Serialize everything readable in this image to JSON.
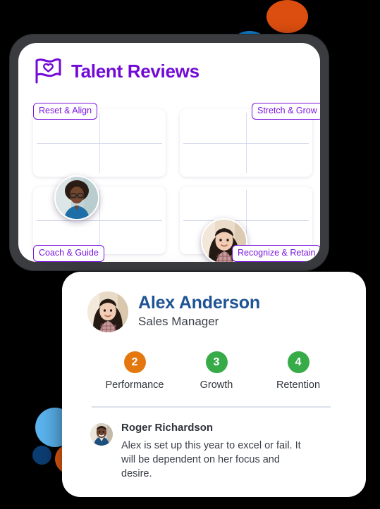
{
  "panel": {
    "title": "Talent Reviews",
    "logo_icon": "flag-heart-icon",
    "brand_color": "#7209D6"
  },
  "grid": {
    "quadrants": [
      {
        "id": "reset-align",
        "tag": "Reset & Align"
      },
      {
        "id": "stretch-grow",
        "tag": "Stretch & Grow"
      },
      {
        "id": "coach-guide",
        "tag": "Coach & Guide"
      },
      {
        "id": "recognize-retain",
        "tag": "Recognize & Retain"
      }
    ],
    "placed_employees": [
      {
        "id": "employee-marker-1",
        "avatar": "woman-glasses-blue-top-avatar"
      },
      {
        "id": "employee-marker-2",
        "avatar": "woman-dark-hair-plaid-avatar"
      }
    ]
  },
  "profile": {
    "avatar_icon": "woman-dark-hair-plaid-avatar",
    "name": "Alex Anderson",
    "role": "Sales Manager",
    "name_color": "#1F5394",
    "scores": [
      {
        "label": "Performance",
        "value": "2",
        "color": "#E4780F"
      },
      {
        "label": "Growth",
        "value": "3",
        "color": "#38AB49"
      },
      {
        "label": "Retention",
        "value": "4",
        "color": "#38AB49"
      }
    ],
    "comment": {
      "avatar_icon": "man-smiling-avatar",
      "author": "Roger Richardson",
      "text": "Alex is set up this year to excel or fail. It will be dependent on her focus and desire."
    }
  },
  "decorations": {
    "circles": [
      {
        "name": "orange-circle-top",
        "color": "#DC4E10"
      },
      {
        "name": "blue-circle-top",
        "color": "#1080CE"
      },
      {
        "name": "dark-circle-top",
        "color": "#26292E"
      },
      {
        "name": "light-blue-circle-bottom",
        "color": "#5BB4F0"
      },
      {
        "name": "navy-circle-bottom",
        "color": "#0C3D72"
      },
      {
        "name": "orange-circle-bottom",
        "color": "#E85C12"
      }
    ]
  }
}
